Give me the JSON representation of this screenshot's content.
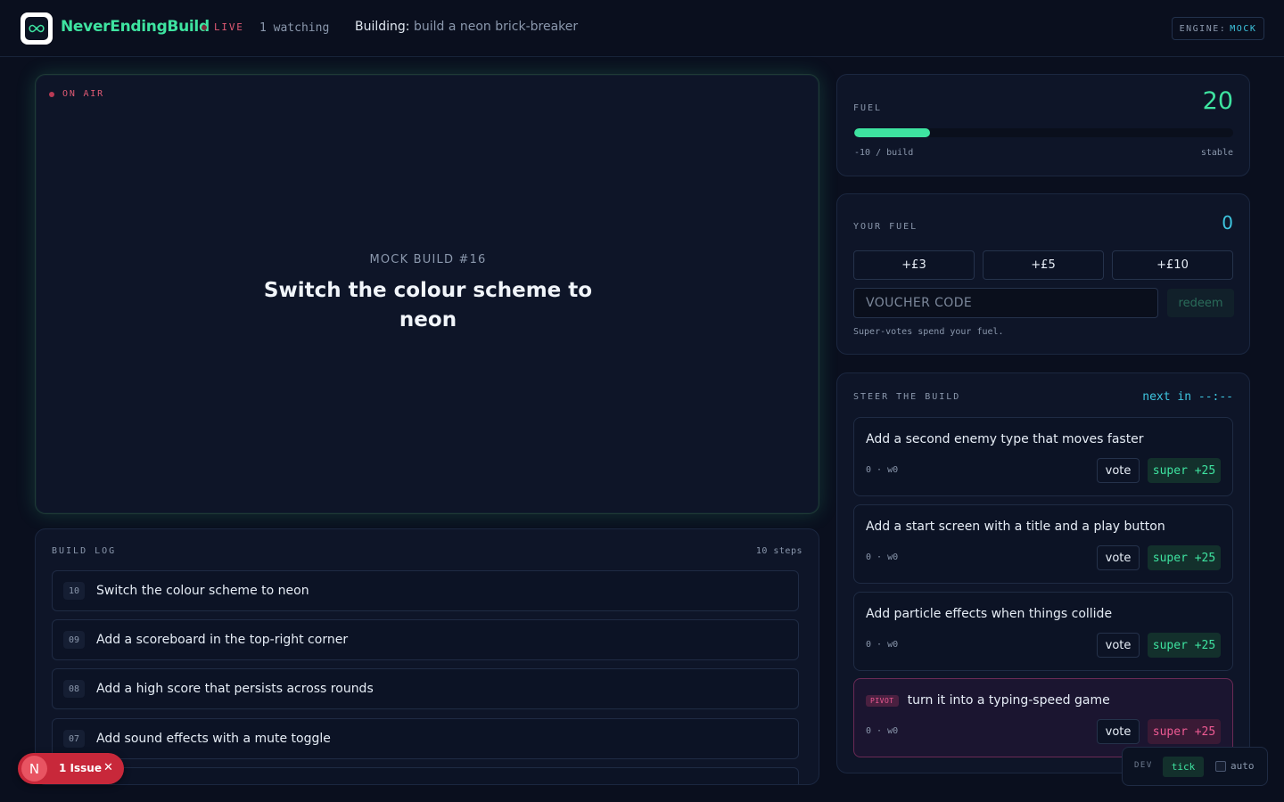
{
  "header": {
    "brand": "NeverEndingBuild",
    "live": "LIVE",
    "watching": "1 watching",
    "building_label": "Building:",
    "building_value": "build a neon brick-breaker",
    "engine_label": "ENGINE:",
    "engine_value": "MOCK"
  },
  "stage": {
    "onair": "ON AIR",
    "mock_label": "MOCK BUILD #16",
    "mock_title": "Switch the colour scheme to neon"
  },
  "build_log": {
    "label": "BUILD LOG",
    "count": "10 steps",
    "items": [
      {
        "num": "10",
        "text": "Switch the colour scheme to neon"
      },
      {
        "num": "09",
        "text": "Add a scoreboard in the top-right corner"
      },
      {
        "num": "08",
        "text": "Add a high score that persists across rounds"
      },
      {
        "num": "07",
        "text": "Add sound effects with a mute toggle"
      }
    ]
  },
  "fuel": {
    "label": "FUEL",
    "value": "20",
    "level_percent": 20,
    "rate": "-10 / build",
    "state": "stable"
  },
  "your_fuel": {
    "label": "YOUR FUEL",
    "value": "0",
    "topups": [
      "+£3",
      "+£5",
      "+£10"
    ],
    "voucher_placeholder": "VOUCHER CODE",
    "redeem": "redeem",
    "note": "Super-votes spend your fuel."
  },
  "steer": {
    "label": "STEER THE BUILD",
    "next_in": "next in --:--",
    "options": [
      {
        "title": "Add a second enemy type that moves faster",
        "meta": "0 · w0",
        "vote": "vote",
        "super": "super +25",
        "pivot": false
      },
      {
        "title": "Add a start screen with a title and a play button",
        "meta": "0 · w0",
        "vote": "vote",
        "super": "super +25",
        "pivot": false
      },
      {
        "title": "Add particle effects when things collide",
        "meta": "0 · w0",
        "vote": "vote",
        "super": "super +25",
        "pivot": false
      },
      {
        "title": "turn it into a typing-speed game",
        "meta": "0 · w0",
        "vote": "vote",
        "super": "super +25",
        "pivot": true,
        "badge": "PIVOT"
      }
    ]
  },
  "dev": {
    "label": "DEV",
    "tick": "tick",
    "auto": "auto"
  },
  "issue": {
    "avatar": "N",
    "text": "1 Issue",
    "close": "✕"
  },
  "colors": {
    "accent_green": "#3ee3a0",
    "accent_cyan": "#3ec6e0",
    "live_red": "#e05a74",
    "pivot_pink": "#ee5a93",
    "background": "#0a0f1e"
  }
}
